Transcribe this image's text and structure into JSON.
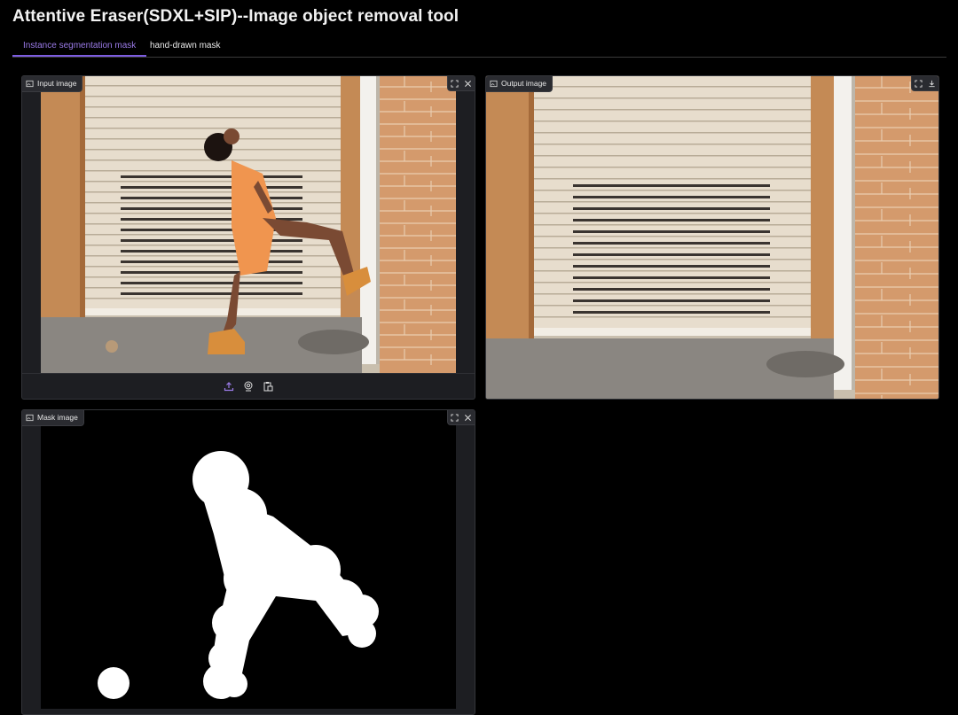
{
  "app": {
    "title": "Attentive Eraser(SDXL+SIP)--Image object removal tool"
  },
  "tabs": [
    {
      "label": "Instance segmentation mask",
      "active": true
    },
    {
      "label": "hand-drawn mask",
      "active": false
    }
  ],
  "panels": {
    "input": {
      "label": "Input image"
    },
    "output": {
      "label": "Output image"
    },
    "mask": {
      "label": "Mask image"
    }
  },
  "icons": {
    "panel_label": "image-icon",
    "fullscreen": "fullscreen-icon",
    "close": "close-icon",
    "download": "download-icon",
    "upload": "upload-icon",
    "webcam": "webcam-icon",
    "clipboard": "clipboard-icon"
  },
  "colors": {
    "accent": "#7c5ce0",
    "background": "#000000",
    "panel": "#1d1e22"
  }
}
